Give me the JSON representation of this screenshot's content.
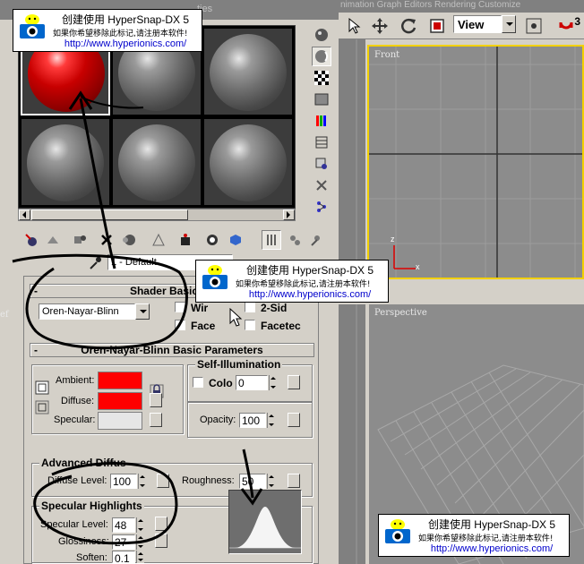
{
  "material_editor": {
    "title_fragment": "ties",
    "material_name": "1 - Default",
    "shader_basic": {
      "header": "Shader Basic Pa",
      "shader_type": "Oren-Nayar-Blinn",
      "wire_label": "Wir",
      "two_sided_label": "2-Sid",
      "face_map_label": "Face",
      "faceted_label": "Facetec"
    },
    "onb_basic": {
      "header": "Oren-Nayar-Blinn Basic Parameters",
      "ambient_label": "Ambient:",
      "diffuse_label": "Diffuse:",
      "specular_label": "Specular:",
      "ambient_color": "#ff0000",
      "diffuse_color": "#ff0000",
      "specular_color": "#e6e6e6",
      "lock_icon": "lock-icon",
      "self_illum_title": "Self-Illumination",
      "color_label": "Colo",
      "color_value": "0",
      "opacity_label": "Opacity:",
      "opacity_value": "100"
    },
    "advanced_diffuse": {
      "title": "Advanced Diffus",
      "diffuse_level_label": "Diffuse Level:",
      "diffuse_level_value": "100",
      "roughness_label": "Roughness:",
      "roughness_value": "50"
    },
    "specular_highlights": {
      "title": "Specular Highlights",
      "specular_level_label": "Specular Level:",
      "specular_level_value": "48",
      "glossiness_label": "Glossiness:",
      "glossiness_value": "27",
      "soften_label": "Soften:",
      "soften_value": "0.1"
    }
  },
  "main_toolbar": {
    "menu_text": "nimation   Graph Editors   Rendering   Customize",
    "view_mode": "View",
    "badge": "3"
  },
  "viewports": {
    "front_label": "Front",
    "perspective_label": "Perspective",
    "left_label": "ef",
    "axis_x": "x",
    "axis_z": "z"
  },
  "watermark": {
    "title": "创建使用 HyperSnap-DX 5",
    "note": "如果你希望移除此标记,请注册本软件!",
    "url": "http://www.hyperionics.com/"
  },
  "colors": {
    "viewport_bg": "#8c8c8c",
    "active_viewport_border": "#f2d000",
    "panel": "#d4d0c8"
  }
}
